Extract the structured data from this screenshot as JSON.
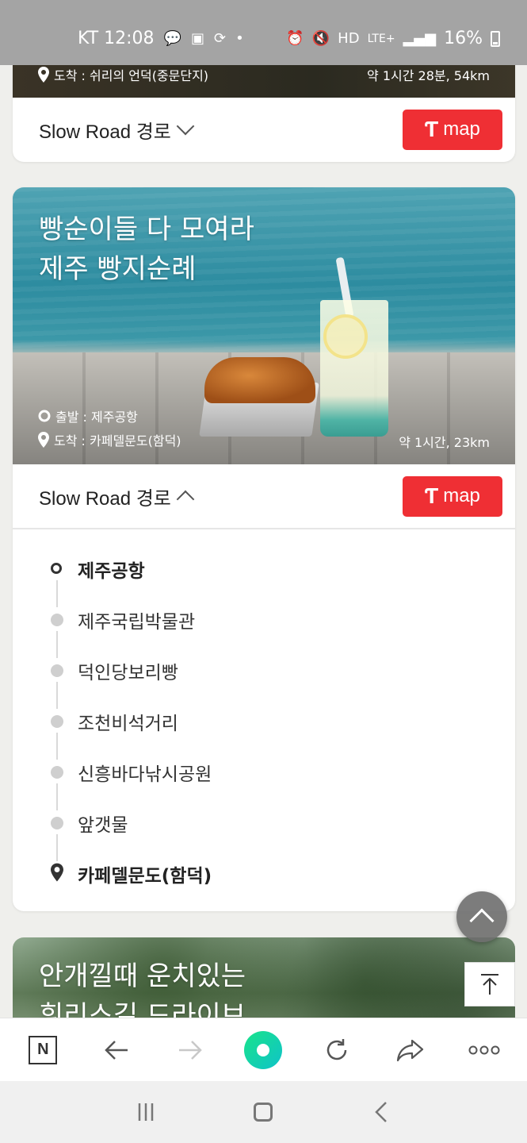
{
  "status_bar": {
    "carrier_time": "KT 12:08",
    "battery": "16%",
    "network": "LTE+"
  },
  "card_prev": {
    "arrival": "도착 : 쉬리의 언덕(중문단지)",
    "distance": "약 1시간 28분, 54km",
    "route_label": "Slow Road 경로",
    "map_label": "map"
  },
  "card_main": {
    "title_line1": "빵순이들 다 모여라",
    "title_line2": "제주 빵지순례",
    "departure": "출발 : 제주공항",
    "arrival": "도착 : 카페델문도(함덕)",
    "distance": "약 1시간, 23km",
    "route_label": "Slow Road 경로",
    "map_label": "map",
    "stops": [
      {
        "name": "제주공항",
        "type": "start"
      },
      {
        "name": "제주국립박물관",
        "type": "mid"
      },
      {
        "name": "덕인당보리빵",
        "type": "mid"
      },
      {
        "name": "조천비석거리",
        "type": "mid"
      },
      {
        "name": "신흥바다낚시공원",
        "type": "mid"
      },
      {
        "name": "앞갯물",
        "type": "mid"
      },
      {
        "name": "카페델문도(함덕)",
        "type": "end"
      }
    ]
  },
  "card_next": {
    "title_line1": "안개낄때 운치있는",
    "title_line2": "휘리스길 드라이브"
  },
  "toolbar": {
    "naver_label": "N"
  },
  "colors": {
    "tmap_red": "#ef2f34",
    "status_bar": "#a4a4a4",
    "background": "#efefec"
  }
}
